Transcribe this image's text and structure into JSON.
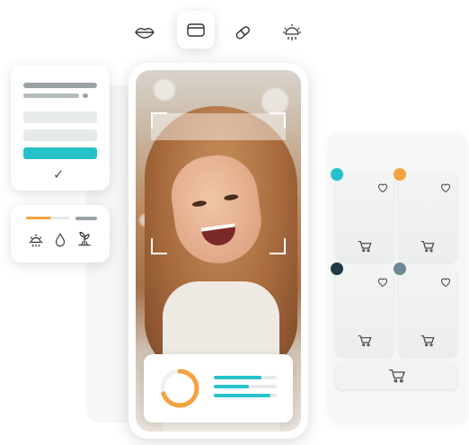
{
  "toolbar": {
    "items": [
      {
        "icon": "lips-icon",
        "active": false
      },
      {
        "icon": "folder-icon",
        "active": true
      },
      {
        "icon": "pill-icon",
        "active": false
      },
      {
        "icon": "sun-rain-icon",
        "active": false
      }
    ]
  },
  "checklist": {
    "check_symbol": "✓"
  },
  "conditions": {
    "icons": [
      "sun-icon",
      "drop-icon",
      "plant-icon"
    ],
    "accent": "#f4a340"
  },
  "analysis": {
    "ring_progress": 0.7,
    "bars": [
      0.75,
      0.55,
      0.9
    ],
    "accent_ring": "#f4a340",
    "accent_bar": "#26c1c9"
  },
  "products": {
    "dot_colors": [
      "#26c1c9",
      "#f4a340",
      "#1f3b46",
      "#6e8894"
    ]
  },
  "colors": {
    "teal": "#26c1c9",
    "orange": "#f4a340",
    "gray": "#9aa2a6",
    "light": "#e6eaeb"
  }
}
